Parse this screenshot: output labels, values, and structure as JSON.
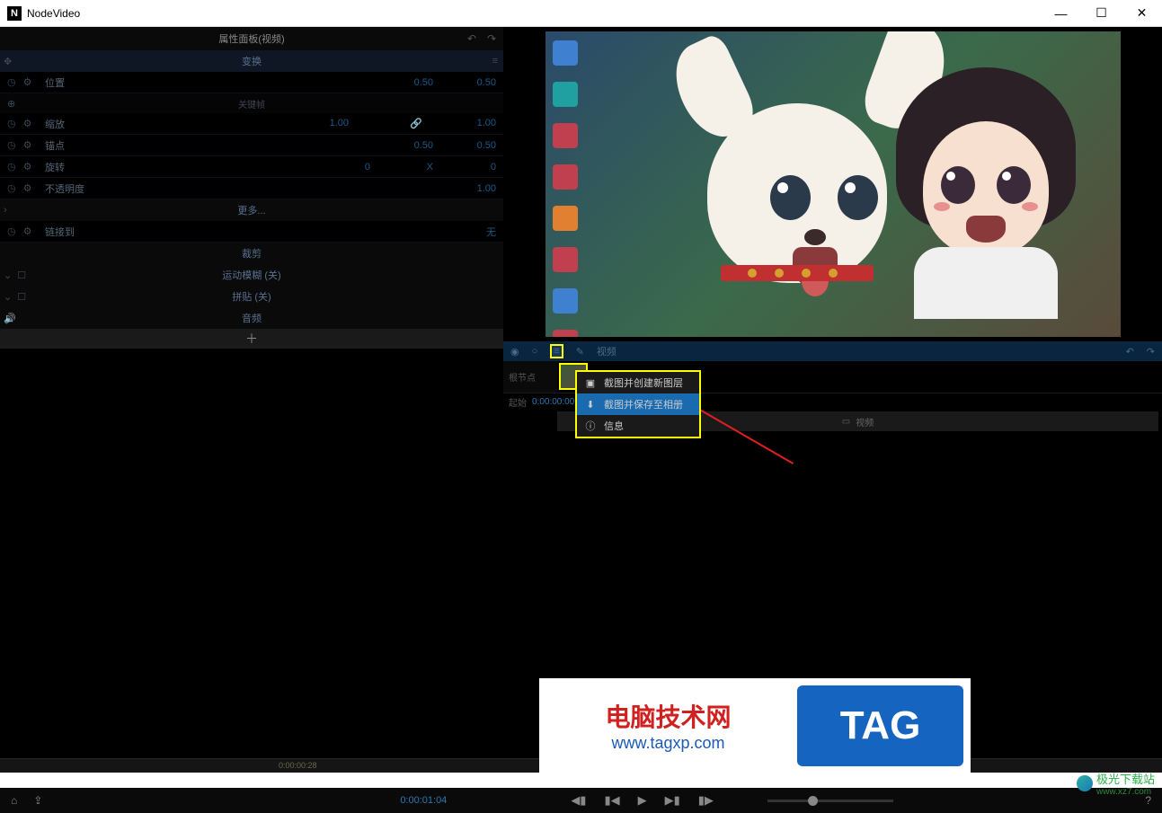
{
  "app": {
    "title": "NodeVideo",
    "icon_letter": "N"
  },
  "window_controls": {
    "min": "—",
    "max": "☐",
    "close": "✕"
  },
  "panel": {
    "title": "属性面板(视频)",
    "undo": "↶",
    "redo": "↷",
    "transform_label": "变换",
    "rows": {
      "position": {
        "label": "位置",
        "v1": "0.50",
        "v2": "0.50"
      },
      "keyframe_sub": "关键帧",
      "scale": {
        "label": "缩放",
        "v1": "1.00",
        "v2": "1.00"
      },
      "anchor": {
        "label": "锚点",
        "v1": "0.50",
        "v2": "0.50"
      },
      "rotate": {
        "label": "旋转",
        "v1": "0",
        "mid": "X",
        "v2": "0"
      },
      "opacity": {
        "label": "不透明度",
        "v1": "1.00"
      },
      "more": "更多...",
      "linkto": {
        "label": "链接到",
        "v1": "无"
      },
      "crop": "裁剪",
      "motion_blur": "运动模糊 (关)",
      "tile": "拼贴 (关)",
      "audio": "音频"
    },
    "add": "＋"
  },
  "preview_toolbar": {
    "eye": "◉",
    "reset": "○",
    "menu": "≡",
    "edit": "✎",
    "video_label": "视频",
    "undo": "↶",
    "redo": "↷"
  },
  "context_menu": {
    "item1": "截图并创建新图层",
    "item2": "截图并保存至相册",
    "item3": "信息"
  },
  "timeline": {
    "track_label": "根节点",
    "start_label": "起始",
    "start_time": "0:00:00:00",
    "clip_label": "视频",
    "ruler_marks": [
      "0:00:00:28"
    ]
  },
  "bottombar": {
    "home": "⌂",
    "export": "⇪",
    "timecode": "0:00:01:04",
    "prev2": "◀▮",
    "prev": "▮◀",
    "play": "▶",
    "next": "▶▮",
    "next2": "▮▶",
    "help": "?"
  },
  "watermark": {
    "title": "电脑技术网",
    "url": "www.tagxp.com",
    "tag": "TAG",
    "site2": "极光下载站",
    "site2url": "www.xz7.com"
  }
}
